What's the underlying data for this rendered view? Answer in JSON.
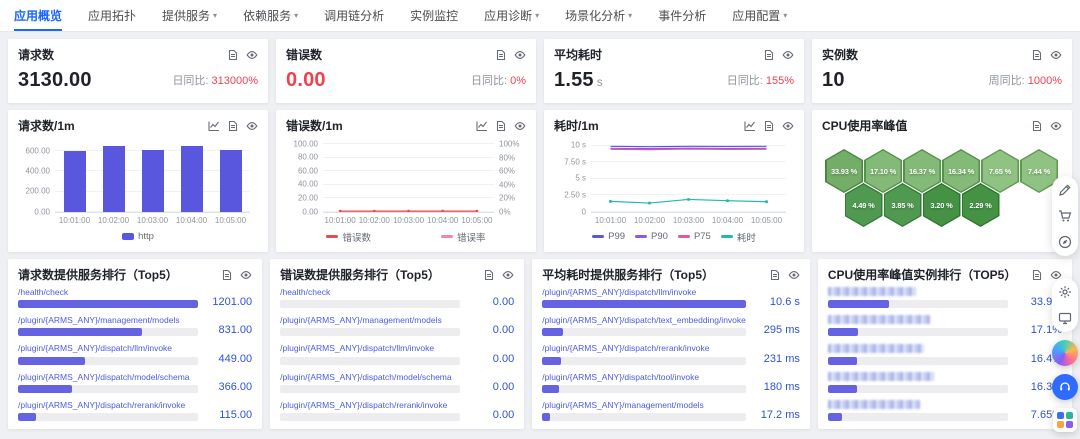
{
  "nav": {
    "items": [
      {
        "label": "应用概览",
        "caret": false,
        "active": true
      },
      {
        "label": "应用拓扑",
        "caret": false,
        "active": false
      },
      {
        "label": "提供服务",
        "caret": true,
        "active": false
      },
      {
        "label": "依赖服务",
        "caret": true,
        "active": false
      },
      {
        "label": "调用链分析",
        "caret": false,
        "active": false
      },
      {
        "label": "实例监控",
        "caret": false,
        "active": false
      },
      {
        "label": "应用诊断",
        "caret": true,
        "active": false
      },
      {
        "label": "场景化分析",
        "caret": true,
        "active": false
      },
      {
        "label": "事件分析",
        "caret": false,
        "active": false
      },
      {
        "label": "应用配置",
        "caret": true,
        "active": false
      }
    ]
  },
  "kpi_cards": [
    {
      "title": "请求数",
      "value": "3130.00",
      "unit": "",
      "value_color": "#1f2329",
      "compare_label": "日同比:",
      "compare_value": "313000%",
      "icons": [
        "document-icon",
        "eye-icon"
      ]
    },
    {
      "title": "错误数",
      "value": "0.00",
      "unit": "",
      "value_color": "#f0414e",
      "compare_label": "日同比:",
      "compare_value": "0%",
      "icons": [
        "document-icon",
        "eye-icon"
      ]
    },
    {
      "title": "平均耗时",
      "value": "1.55",
      "unit": "s",
      "value_color": "#1f2329",
      "compare_label": "日同比:",
      "compare_value": "155%",
      "icons": [
        "document-icon",
        "eye-icon"
      ]
    },
    {
      "title": "实例数",
      "value": "10",
      "unit": "",
      "value_color": "#1f2329",
      "compare_label": "周同比:",
      "compare_value": "1000%",
      "icons": [
        "document-icon",
        "eye-icon"
      ]
    }
  ],
  "chart_data": [
    {
      "type": "bar",
      "title": "请求数/1m",
      "icons": [
        "line-chart-icon",
        "document-icon",
        "eye-icon"
      ],
      "categories": [
        "10:01:00",
        "10:02:00",
        "10:03:00",
        "10:04:00",
        "10:05:00"
      ],
      "series": [
        {
          "name": "http",
          "color": "#5a57df",
          "values": [
            601,
            655,
            607,
            652,
            615
          ]
        }
      ],
      "ylim": [
        0,
        700
      ],
      "yticks": [
        {
          "v": 600,
          "label": "600.00"
        },
        {
          "v": 400,
          "label": "400.00"
        },
        {
          "v": 200,
          "label": "200.00"
        },
        {
          "v": 0,
          "label": "0.00"
        }
      ],
      "legend_position": "bottom"
    },
    {
      "type": "line",
      "title": "错误数/1m",
      "icons": [
        "line-chart-icon",
        "document-icon",
        "eye-icon"
      ],
      "categories": [
        "10:01:00",
        "10:02:00",
        "10:03:00",
        "10:04:00",
        "10:05:00"
      ],
      "series": [
        {
          "name": "错误数",
          "color": "#e74d4d",
          "values": [
            0,
            0,
            0,
            0,
            0
          ],
          "markers": true
        },
        {
          "name": "错误率",
          "color": "#f287ad",
          "values": [
            0,
            0,
            0,
            0,
            0
          ],
          "markers": false
        }
      ],
      "ylim": [
        0,
        105
      ],
      "yticks_left": [
        {
          "v": 100,
          "label": "100.00"
        },
        {
          "v": 80,
          "label": "80.00"
        },
        {
          "v": 60,
          "label": "60.00"
        },
        {
          "v": 40,
          "label": "40.00"
        },
        {
          "v": 20,
          "label": "20.00"
        },
        {
          "v": 0,
          "label": "0.00"
        }
      ],
      "yticks_right": [
        {
          "v": 100,
          "label": "100%"
        },
        {
          "v": 80,
          "label": "80%"
        },
        {
          "v": 60,
          "label": "60%"
        },
        {
          "v": 40,
          "label": "40%"
        },
        {
          "v": 20,
          "label": "20%"
        },
        {
          "v": 0,
          "label": "0%"
        }
      ]
    },
    {
      "type": "line",
      "title": "耗时/1m",
      "icons": [
        "line-chart-icon",
        "document-icon",
        "eye-icon"
      ],
      "categories": [
        "10:01:00",
        "10:02:00",
        "10:03:00",
        "10:04:00",
        "10:05:00"
      ],
      "series": [
        {
          "name": "P99",
          "color": "#5a57df",
          "values": [
            9.9,
            9.85,
            9.9,
            9.88,
            9.9
          ],
          "markers": false
        },
        {
          "name": "P90",
          "color": "#9457df",
          "values": [
            9.6,
            9.55,
            9.62,
            9.58,
            9.6
          ],
          "markers": false
        },
        {
          "name": "P75",
          "color": "#df57ad",
          "values": [
            9.45,
            9.4,
            9.48,
            9.44,
            9.45
          ],
          "markers": false
        },
        {
          "name": "耗时",
          "color": "#1fb9ae",
          "values": [
            1.6,
            1.35,
            1.9,
            1.7,
            1.55
          ],
          "markers": true
        }
      ],
      "ylim": [
        0,
        10.7
      ],
      "yticks_left": [
        {
          "v": 10,
          "label": "10 s"
        },
        {
          "v": 7.5,
          "label": "7.50 s"
        },
        {
          "v": 5,
          "label": "5 s"
        },
        {
          "v": 2.5,
          "label": "2.50 s"
        },
        {
          "v": 0,
          "label": "0"
        }
      ]
    },
    {
      "type": "hexmap",
      "title": "CPU使用率峰值",
      "icons": [
        "document-icon",
        "eye-icon"
      ],
      "unit": "%",
      "rows": [
        [
          {
            "label": "33.93 %",
            "fill": "#74ad68",
            "border": "#49873f"
          },
          {
            "label": "17.10 %",
            "fill": "#83ba77",
            "border": "#54924a"
          },
          {
            "label": "16.37 %",
            "fill": "#83ba77",
            "border": "#54924a"
          },
          {
            "label": "16.34 %",
            "fill": "#83ba77",
            "border": "#54924a"
          },
          {
            "label": "7.65 %",
            "fill": "#90c383",
            "border": "#5d9a52"
          },
          {
            "label": "7.44 %",
            "fill": "#90c383",
            "border": "#5d9a52"
          }
        ],
        [
          {
            "label": "4.49 %",
            "fill": "#4f9a50",
            "border": "#357c38"
          },
          {
            "label": "3.85 %",
            "fill": "#4f9a50",
            "border": "#357c38"
          },
          {
            "label": "3.20 %",
            "fill": "#459245",
            "border": "#2e752f"
          },
          {
            "label": "2.29 %",
            "fill": "#459245",
            "border": "#2e752f"
          }
        ]
      ]
    }
  ],
  "tables": [
    {
      "title": "请求数提供服务排行（Top5）",
      "icons": [
        "document-icon",
        "eye-icon"
      ],
      "rows": [
        {
          "label": "/health/check",
          "value": "1201.00",
          "pct": 100
        },
        {
          "label": "/plugin/{ARMS_ANY}/management/models",
          "value": "831.00",
          "pct": 69
        },
        {
          "label": "/plugin/{ARMS_ANY}/dispatch/llm/invoke",
          "value": "449.00",
          "pct": 37
        },
        {
          "label": "/plugin/{ARMS_ANY}/dispatch/model/schema",
          "value": "366.00",
          "pct": 30
        },
        {
          "label": "/plugin/{ARMS_ANY}/dispatch/rerank/invoke",
          "value": "115.00",
          "pct": 10
        }
      ]
    },
    {
      "title": "错误数提供服务排行（Top5）",
      "icons": [
        "document-icon",
        "eye-icon"
      ],
      "rows": [
        {
          "label": "/health/check",
          "value": "0.00",
          "pct": 0
        },
        {
          "label": "/plugin/{ARMS_ANY}/management/models",
          "value": "0.00",
          "pct": 0
        },
        {
          "label": "/plugin/{ARMS_ANY}/dispatch/llm/invoke",
          "value": "0.00",
          "pct": 0
        },
        {
          "label": "/plugin/{ARMS_ANY}/dispatch/model/schema",
          "value": "0.00",
          "pct": 0
        },
        {
          "label": "/plugin/{ARMS_ANY}/dispatch/rerank/invoke",
          "value": "0.00",
          "pct": 0
        }
      ]
    },
    {
      "title": "平均耗时提供服务排行（Top5）",
      "icons": [
        "document-icon",
        "eye-icon"
      ],
      "rows": [
        {
          "label": "/plugin/{ARMS_ANY}/dispatch/llm/invoke",
          "value": "10.6 s",
          "pct": 100
        },
        {
          "label": "/plugin/{ARMS_ANY}/dispatch/text_embedding/invoke",
          "value": "295 ms",
          "pct": 10
        },
        {
          "label": "/plugin/{ARMS_ANY}/dispatch/rerank/invoke",
          "value": "231 ms",
          "pct": 9
        },
        {
          "label": "/plugin/{ARMS_ANY}/dispatch/tool/invoke",
          "value": "180 ms",
          "pct": 8
        },
        {
          "label": "/plugin/{ARMS_ANY}/management/models",
          "value": "17.2 ms",
          "pct": 4
        }
      ]
    },
    {
      "title": "CPU使用率峰值实例排行（TOP5）",
      "icons": [
        "document-icon",
        "eye-icon"
      ],
      "rows": [
        {
          "redacted": true,
          "blur_w": 88,
          "value": "33.9%",
          "pct": 34
        },
        {
          "redacted": true,
          "blur_w": 102,
          "value": "17.1%",
          "pct": 17
        },
        {
          "redacted": true,
          "blur_w": 96,
          "value": "16.4%",
          "pct": 16
        },
        {
          "redacted": true,
          "blur_w": 106,
          "value": "16.3%",
          "pct": 16
        },
        {
          "redacted": true,
          "blur_w": 92,
          "value": "7.65%",
          "pct": 8
        }
      ]
    }
  ],
  "right_rail": {
    "pill1": [
      "edit-icon",
      "cart-icon",
      "compass-icon"
    ],
    "pill2": [
      "gear-icon",
      "monitor-icon"
    ],
    "logo_colors": [
      "#3b6ef5",
      "#2bb3a3",
      "#f5a53b",
      "#8a5cf6"
    ]
  },
  "colors": {
    "accent_blue": "#1a66ff",
    "bar_purple": "#5a57df",
    "alert_red": "#f0414e",
    "link_blue": "#4d5be0",
    "value_blue": "#2e54d0",
    "hex_green": "#74ad68"
  }
}
